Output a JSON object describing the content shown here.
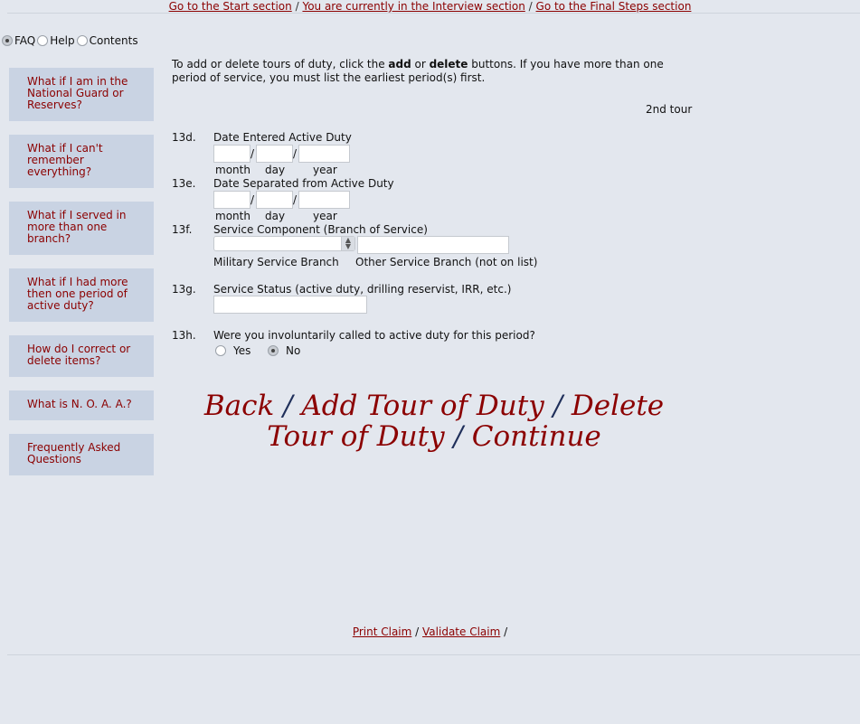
{
  "top_nav": {
    "start": "Go to the Start section",
    "current": "You are currently in the Interview section",
    "final": "Go to the Final Steps section",
    "sep": "/"
  },
  "view_options": {
    "faq": "FAQ",
    "help": "Help",
    "contents": "Contents",
    "selected": "FAQ"
  },
  "sidebar": {
    "items": [
      {
        "label": "What if I am in the National Guard or Reserves?"
      },
      {
        "label": "What if I can't remember everything?"
      },
      {
        "label": "What if I served in more than one branch?"
      },
      {
        "label": "What if I had more then one period of active duty?"
      },
      {
        "label": "How do I correct or delete items?"
      },
      {
        "label": "What is N. O. A. A.?"
      },
      {
        "label": "Frequently Asked Questions"
      }
    ]
  },
  "intro": {
    "before": "To add or delete tours of duty, click the ",
    "add": "add",
    "or": " or ",
    "delete": "delete",
    "after": " buttons. If you have more than one period of service, you must list the earliest period(s) first."
  },
  "tour_label": "2nd tour",
  "questions": {
    "q13d": {
      "num": "13d.",
      "label": "Date Entered Active Duty",
      "month": "",
      "day": "",
      "year": ""
    },
    "q13e": {
      "num": "13e.",
      "label": "Date Separated from Active Duty",
      "month": "",
      "day": "",
      "year": ""
    },
    "q13f": {
      "num": "13f.",
      "label": "Service Component (Branch of Service)",
      "branch_value": "",
      "other_value": "",
      "branch_caption": "Military Service Branch",
      "other_caption": "Other Service Branch (not on list)"
    },
    "q13g": {
      "num": "13g.",
      "label": "Service Status (active duty, drilling reservist, IRR, etc.)",
      "value": ""
    },
    "q13h": {
      "num": "13h.",
      "label": "Were you involuntarily called to active duty for this period?",
      "yes": "Yes",
      "no": "No",
      "selected": "No"
    }
  },
  "date_captions": {
    "month": "month",
    "day": "day",
    "year": "year",
    "sep": "/"
  },
  "actions": {
    "back": "Back",
    "add": "Add Tour of Duty",
    "delete": "Delete Tour of Duty",
    "continue": "Continue",
    "sep": "/"
  },
  "bottom_nav": {
    "print": "Print Claim",
    "validate": "Validate Claim",
    "sep": "/"
  },
  "colors": {
    "link": "#8b0000",
    "sidebar_bg": "#c9d3e3",
    "page_bg": "#e3e7ee",
    "action_sep": "#1f2f5a"
  }
}
